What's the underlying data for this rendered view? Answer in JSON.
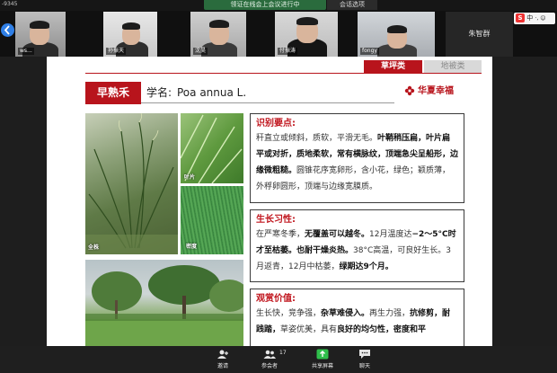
{
  "window": {
    "corner_id": "-9345",
    "meeting_title": "领证在线会上会议进行中",
    "sharing_label": "会话选项"
  },
  "participants": [
    {
      "name": "ws..."
    },
    {
      "name": "孙振天"
    },
    {
      "name": "沈昊"
    },
    {
      "name": "付振涛"
    },
    {
      "name": "fongy"
    },
    {
      "name": "朱智群"
    }
  ],
  "ime": {
    "logo": "S",
    "mode": "中",
    "extra": "·, ☺"
  },
  "slide": {
    "tabs": {
      "active": "草坪类",
      "inactive": "地被类"
    },
    "plant_name": "早熟禾",
    "sci_label": "学名:",
    "sci_name": "Poa annua L.",
    "brand": "华夏幸福",
    "photo_captions": {
      "whole": "全株",
      "leaf": "叶片",
      "turf": "密度"
    },
    "identification": {
      "title": "识别要点:",
      "text_1": "秆直立或倾斜，质软，平滑无毛。",
      "bold_1": "叶鞘稍压扁，叶片扁平或对折，质地柔软，常有横脉纹，顶端急尖呈船形，边缘微粗糙。",
      "text_2": "圆锥花序宽卵形，含小花，绿色；颖质薄，外稃卵圆形，顶端与边缘宽膜质。"
    },
    "growth": {
      "title": "生长习性:",
      "text_1": "在严寒冬季，",
      "bold_1": "无覆盖可以越冬。",
      "text_2": "12月温度达",
      "bold_2": "−2～5°C时才至枯萎。也耐干燥炎热。",
      "text_3": "38°C高温，可良好生长。3月返青，12月中枯萎，",
      "bold_3": "绿期达9个月。"
    },
    "ornamental": {
      "title": "观赏价值:",
      "text_1": "生长快，竞争强，",
      "bold_1": "杂草难侵入。",
      "text_2": "再生力强，",
      "bold_2": "抗修剪，耐践踏，",
      "text_3": "草姿优美，具有",
      "bold_3": "良好的均匀性，密度和平"
    }
  },
  "toolbar": {
    "invite": "邀请",
    "participants": "参会者",
    "participant_count": "17",
    "share": "共享屏幕",
    "chat": "聊天"
  },
  "colors": {
    "accent": "#b8141c",
    "background": "#1e1e1e"
  }
}
